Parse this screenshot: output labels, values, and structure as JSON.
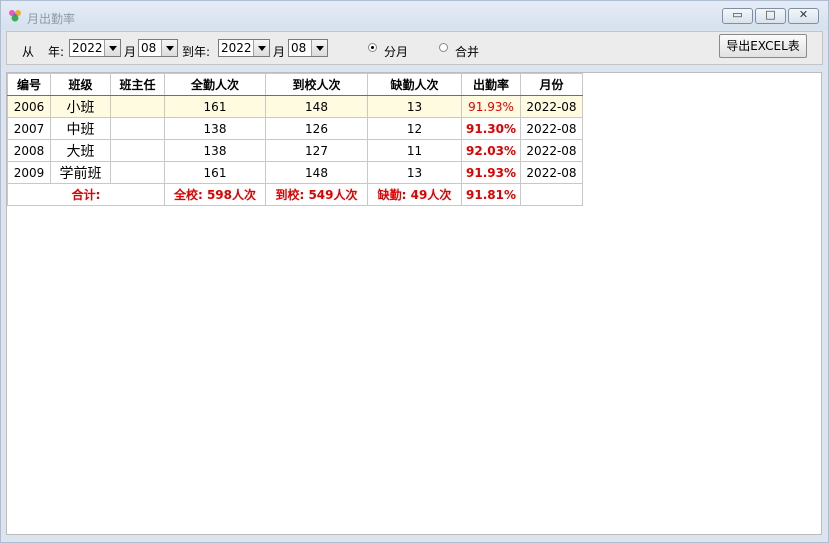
{
  "window": {
    "title": "月出勤率",
    "controls": [
      "minimize-icon",
      "maximize-icon",
      "close-icon"
    ]
  },
  "toolbar": {
    "from_label": "从",
    "year_label": "年:",
    "year_from": "2022",
    "month_label": "月",
    "month_from": "08",
    "to_label": "到年:",
    "year_to": "2022",
    "month_label2": "月",
    "month_to": "08",
    "radio_monthly": "分月",
    "radio_merge": "合并",
    "selected_radio": "分月",
    "export_label": "导出EXCEL表"
  },
  "table": {
    "headers": [
      "编号",
      "班级",
      "班主任",
      "全勤人次",
      "到校人次",
      "缺勤人次",
      "出勤率",
      "月份"
    ],
    "rows": [
      {
        "id": "2006",
        "class": "小班",
        "teacher": "",
        "full": "161",
        "arrived": "148",
        "absent": "13",
        "rate": "91.93%",
        "month": "2022-08"
      },
      {
        "id": "2007",
        "class": "中班",
        "teacher": "",
        "full": "138",
        "arrived": "126",
        "absent": "12",
        "rate": "91.30%",
        "month": "2022-08"
      },
      {
        "id": "2008",
        "class": "大班",
        "teacher": "",
        "full": "138",
        "arrived": "127",
        "absent": "11",
        "rate": "92.03%",
        "month": "2022-08"
      },
      {
        "id": "2009",
        "class": "学前班",
        "teacher": "",
        "full": "161",
        "arrived": "148",
        "absent": "13",
        "rate": "91.93%",
        "month": "2022-08"
      }
    ],
    "total": {
      "label": "合计:",
      "full": "全校: 598人次",
      "arrived": "到校: 549人次",
      "absent": "缺勤: 49人次",
      "rate": "91.81%",
      "month": ""
    }
  },
  "colors": {
    "accent_red": "#e00000",
    "selected_row": "#fffbe1"
  }
}
